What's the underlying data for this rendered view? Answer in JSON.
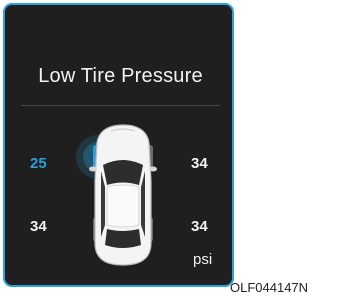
{
  "display": {
    "title": "Low Tire Pressure",
    "unit": "psi",
    "tires": {
      "front_left": "25",
      "front_right": "34",
      "rear_left": "34",
      "rear_right": "34"
    },
    "low_tire": "front_left"
  },
  "image_code": "OLF044147N",
  "colors": {
    "panel_background": "#1f1f1f",
    "panel_border": "#2aa3dd",
    "warning_blue": "#2d9fd8",
    "text": "#f2f2f2"
  }
}
